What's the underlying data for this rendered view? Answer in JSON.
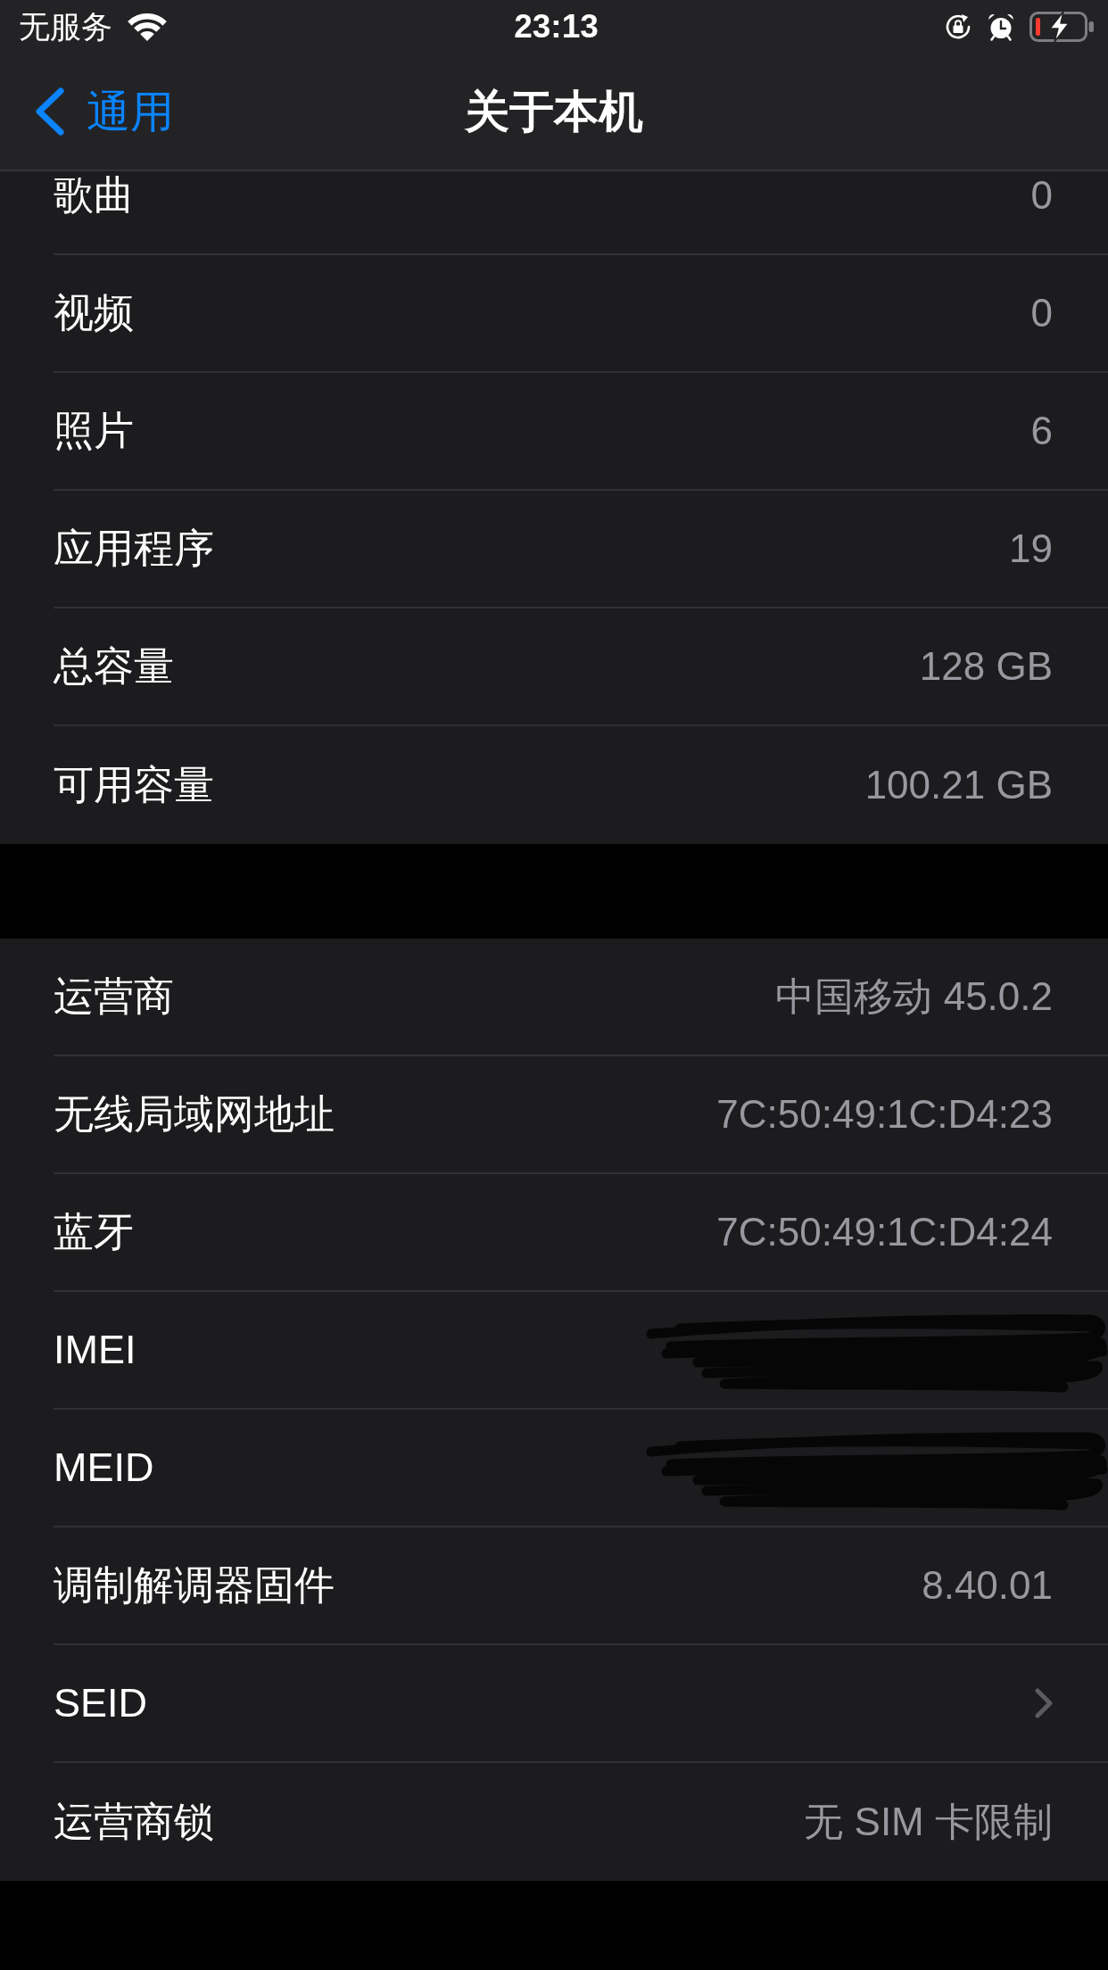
{
  "status_bar": {
    "carrier": "无服务",
    "time": "23:13"
  },
  "nav_bar": {
    "back_label": "通用",
    "title": "关于本机"
  },
  "groups": [
    {
      "rows": [
        {
          "kind": "value",
          "label": "歌曲",
          "value": "0"
        },
        {
          "kind": "value",
          "label": "视频",
          "value": "0"
        },
        {
          "kind": "value",
          "label": "照片",
          "value": "6"
        },
        {
          "kind": "value",
          "label": "应用程序",
          "value": "19"
        },
        {
          "kind": "value",
          "label": "总容量",
          "value": "128 GB"
        },
        {
          "kind": "value",
          "label": "可用容量",
          "value": "100.21 GB"
        }
      ]
    },
    {
      "rows": [
        {
          "kind": "value",
          "label": "运营商",
          "value": "中国移动 45.0.2"
        },
        {
          "kind": "value",
          "label": "无线局域网地址",
          "value": "7C:50:49:1C:D4:23"
        },
        {
          "kind": "value",
          "label": "蓝牙",
          "value": "7C:50:49:1C:D4:24"
        },
        {
          "kind": "redacted",
          "label": "IMEI"
        },
        {
          "kind": "redacted",
          "label": "MEID"
        },
        {
          "kind": "value",
          "label": "调制解调器固件",
          "value": "8.40.01"
        },
        {
          "kind": "link",
          "label": "SEID"
        },
        {
          "kind": "value",
          "label": "运营商锁",
          "value": "无 SIM 卡限制"
        }
      ]
    }
  ]
}
